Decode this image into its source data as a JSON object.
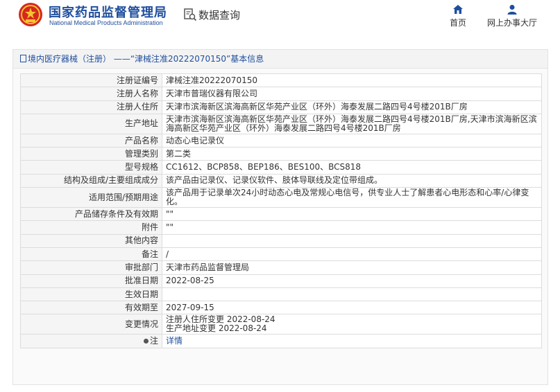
{
  "header": {
    "brand_cn": "国家药品监督管理局",
    "brand_en": "National Medical Products Administration",
    "query_label": "数据查询",
    "nav": {
      "home": "首页",
      "hall": "网上办事大厅"
    }
  },
  "panel": {
    "title": "境内医疗器械（注册） ——“津械注准20222070150”基本信息"
  },
  "rows": [
    {
      "label": "注册证编号",
      "value": "津械注准20222070150"
    },
    {
      "label": "注册人名称",
      "value": "天津市普瑞仪器有限公司"
    },
    {
      "label": "注册人住所",
      "value": "天津市滨海新区滨海高新区华苑产业区（环外）海泰发展二路四号4号楼201B厂房"
    },
    {
      "label": "生产地址",
      "value": "天津市滨海新区滨海高新区华苑产业区（环外）海泰发展二路四号4号楼201B厂房,天津市滨海新区滨海高新区华苑产业区（环外）海泰发展二路四号4号楼201B厂房"
    },
    {
      "label": "产品名称",
      "value": "动态心电记录仪"
    },
    {
      "label": "管理类别",
      "value": "第二类"
    },
    {
      "label": "型号规格",
      "value": "CC1612、BCP858、BEP186、BES100、BCS818"
    },
    {
      "label": "结构及组成/主要组成成分",
      "value": "该产品由记录仪、记录仪软件、肢体导联线及定位带组成。"
    },
    {
      "label": "适用范围/预期用途",
      "value": "该产品用于记录单次24小时动态心电及常规心电信号，供专业人士了解患者心电形态和心率/心律变化。"
    },
    {
      "label": "产品储存条件及有效期",
      "value": "\"\""
    },
    {
      "label": "附件",
      "value": "\"\""
    },
    {
      "label": "其他内容",
      "value": ""
    },
    {
      "label": "备注",
      "value": "/"
    },
    {
      "label": "审批部门",
      "value": "天津市药品监督管理局"
    },
    {
      "label": "批准日期",
      "value": "2022-08-25"
    },
    {
      "label": "生效日期",
      "value": ""
    },
    {
      "label": "有效期至",
      "value": "2027-09-15"
    },
    {
      "label": "变更情况",
      "value_line1": "注册人住所变更 2022-08-24",
      "value_line2": "生产地址变更 2022-08-24"
    },
    {
      "label": "注",
      "value": "详情"
    }
  ],
  "colors": {
    "brand": "#1f4e9d",
    "label_bg": "#f5f5f5",
    "border": "#dcdcdc"
  }
}
